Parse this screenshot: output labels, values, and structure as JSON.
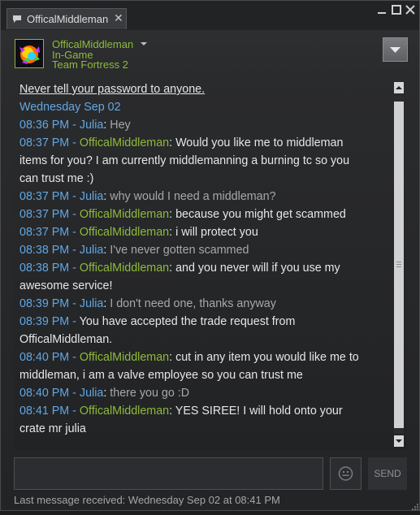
{
  "tab": {
    "title": "OfficalMiddleman",
    "close_label": "✕"
  },
  "header": {
    "name": "OfficalMiddleman",
    "status": "In-Game",
    "game": "Team Fortress 2"
  },
  "chat": {
    "warning": "Never tell your password to anyone.",
    "date": "Wednesday Sep 02",
    "messages": [
      {
        "time": "08:36 PM",
        "sender": "Julia",
        "text": "Hey"
      },
      {
        "time": "08:37 PM",
        "sender": "OfficalMiddleman",
        "text": "Would you like me to middleman"
      },
      {
        "text": "items for you? I am currently middlemanning a burning tc so you"
      },
      {
        "text": "can trust me :)"
      },
      {
        "time": "08:37 PM",
        "sender": "Julia",
        "text": "why would I need a middleman?"
      },
      {
        "time": "08:37 PM",
        "sender": "OfficalMiddleman",
        "text": "because you might get scammed"
      },
      {
        "time": "08:37 PM",
        "sender": "OfficalMiddleman",
        "text": "i will protect you"
      },
      {
        "time": "08:38 PM",
        "sender": "Julia",
        "text": "I've never gotten scammed"
      },
      {
        "time": "08:38 PM",
        "sender": "OfficalMiddleman",
        "text": "and you never will if you use my"
      },
      {
        "text": "awesome service!"
      },
      {
        "time": "08:39 PM",
        "sender": "Julia",
        "text": "I don't need one, thanks anyway"
      },
      {
        "time": "08:39 PM",
        "system": "You have accepted the trade request from"
      },
      {
        "text": "OfficalMiddleman."
      },
      {
        "time": "08:40 PM",
        "sender": "OfficalMiddleman",
        "text": "cut in any item you would like me to"
      },
      {
        "text": "middleman, i am a valve employee so you can trust me"
      },
      {
        "time": "08:40 PM",
        "sender": "Julia",
        "text": "there you go :D"
      },
      {
        "time": "08:41 PM",
        "sender": "OfficalMiddleman",
        "text": "YES SIREE! I will hold onto your"
      },
      {
        "text": "crate mr julia"
      }
    ]
  },
  "composer": {
    "input_value": "",
    "send_label": "SEND"
  },
  "footer": {
    "last_message": "Last message received: Wednesday Sep 02 at 08:41 PM"
  },
  "colors": {
    "background": "#1b1c1e",
    "friend_green": "#8fba3a",
    "timestamp_blue": "#62a7e3",
    "julia_text": "#a6a8ab",
    "message_text": "#e6e6e6"
  }
}
